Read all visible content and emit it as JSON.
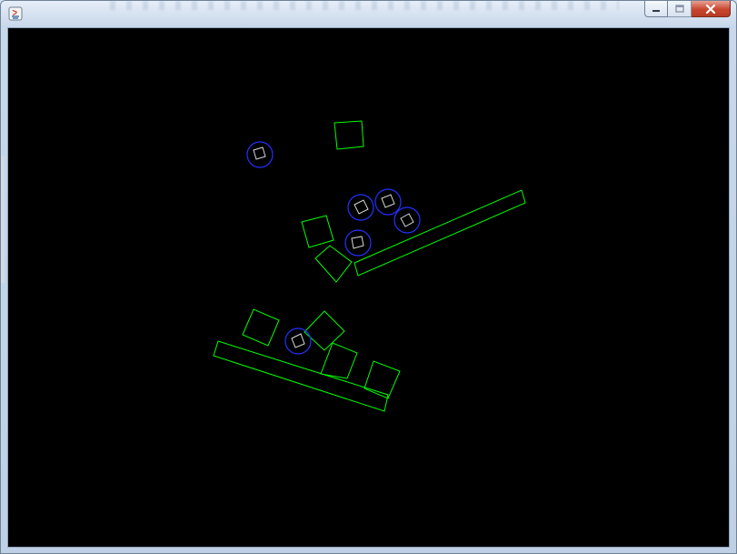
{
  "window": {
    "title": "",
    "app_icon": "java-icon",
    "controls": {
      "minimize": "minimize-icon",
      "maximize": "maximize-icon",
      "close": "close-icon"
    }
  },
  "canvas": {
    "background": "#000000",
    "colors": {
      "box": "#00ff00",
      "circle_outline": "#1f2dff",
      "inner_square": "#dddddd"
    }
  }
}
